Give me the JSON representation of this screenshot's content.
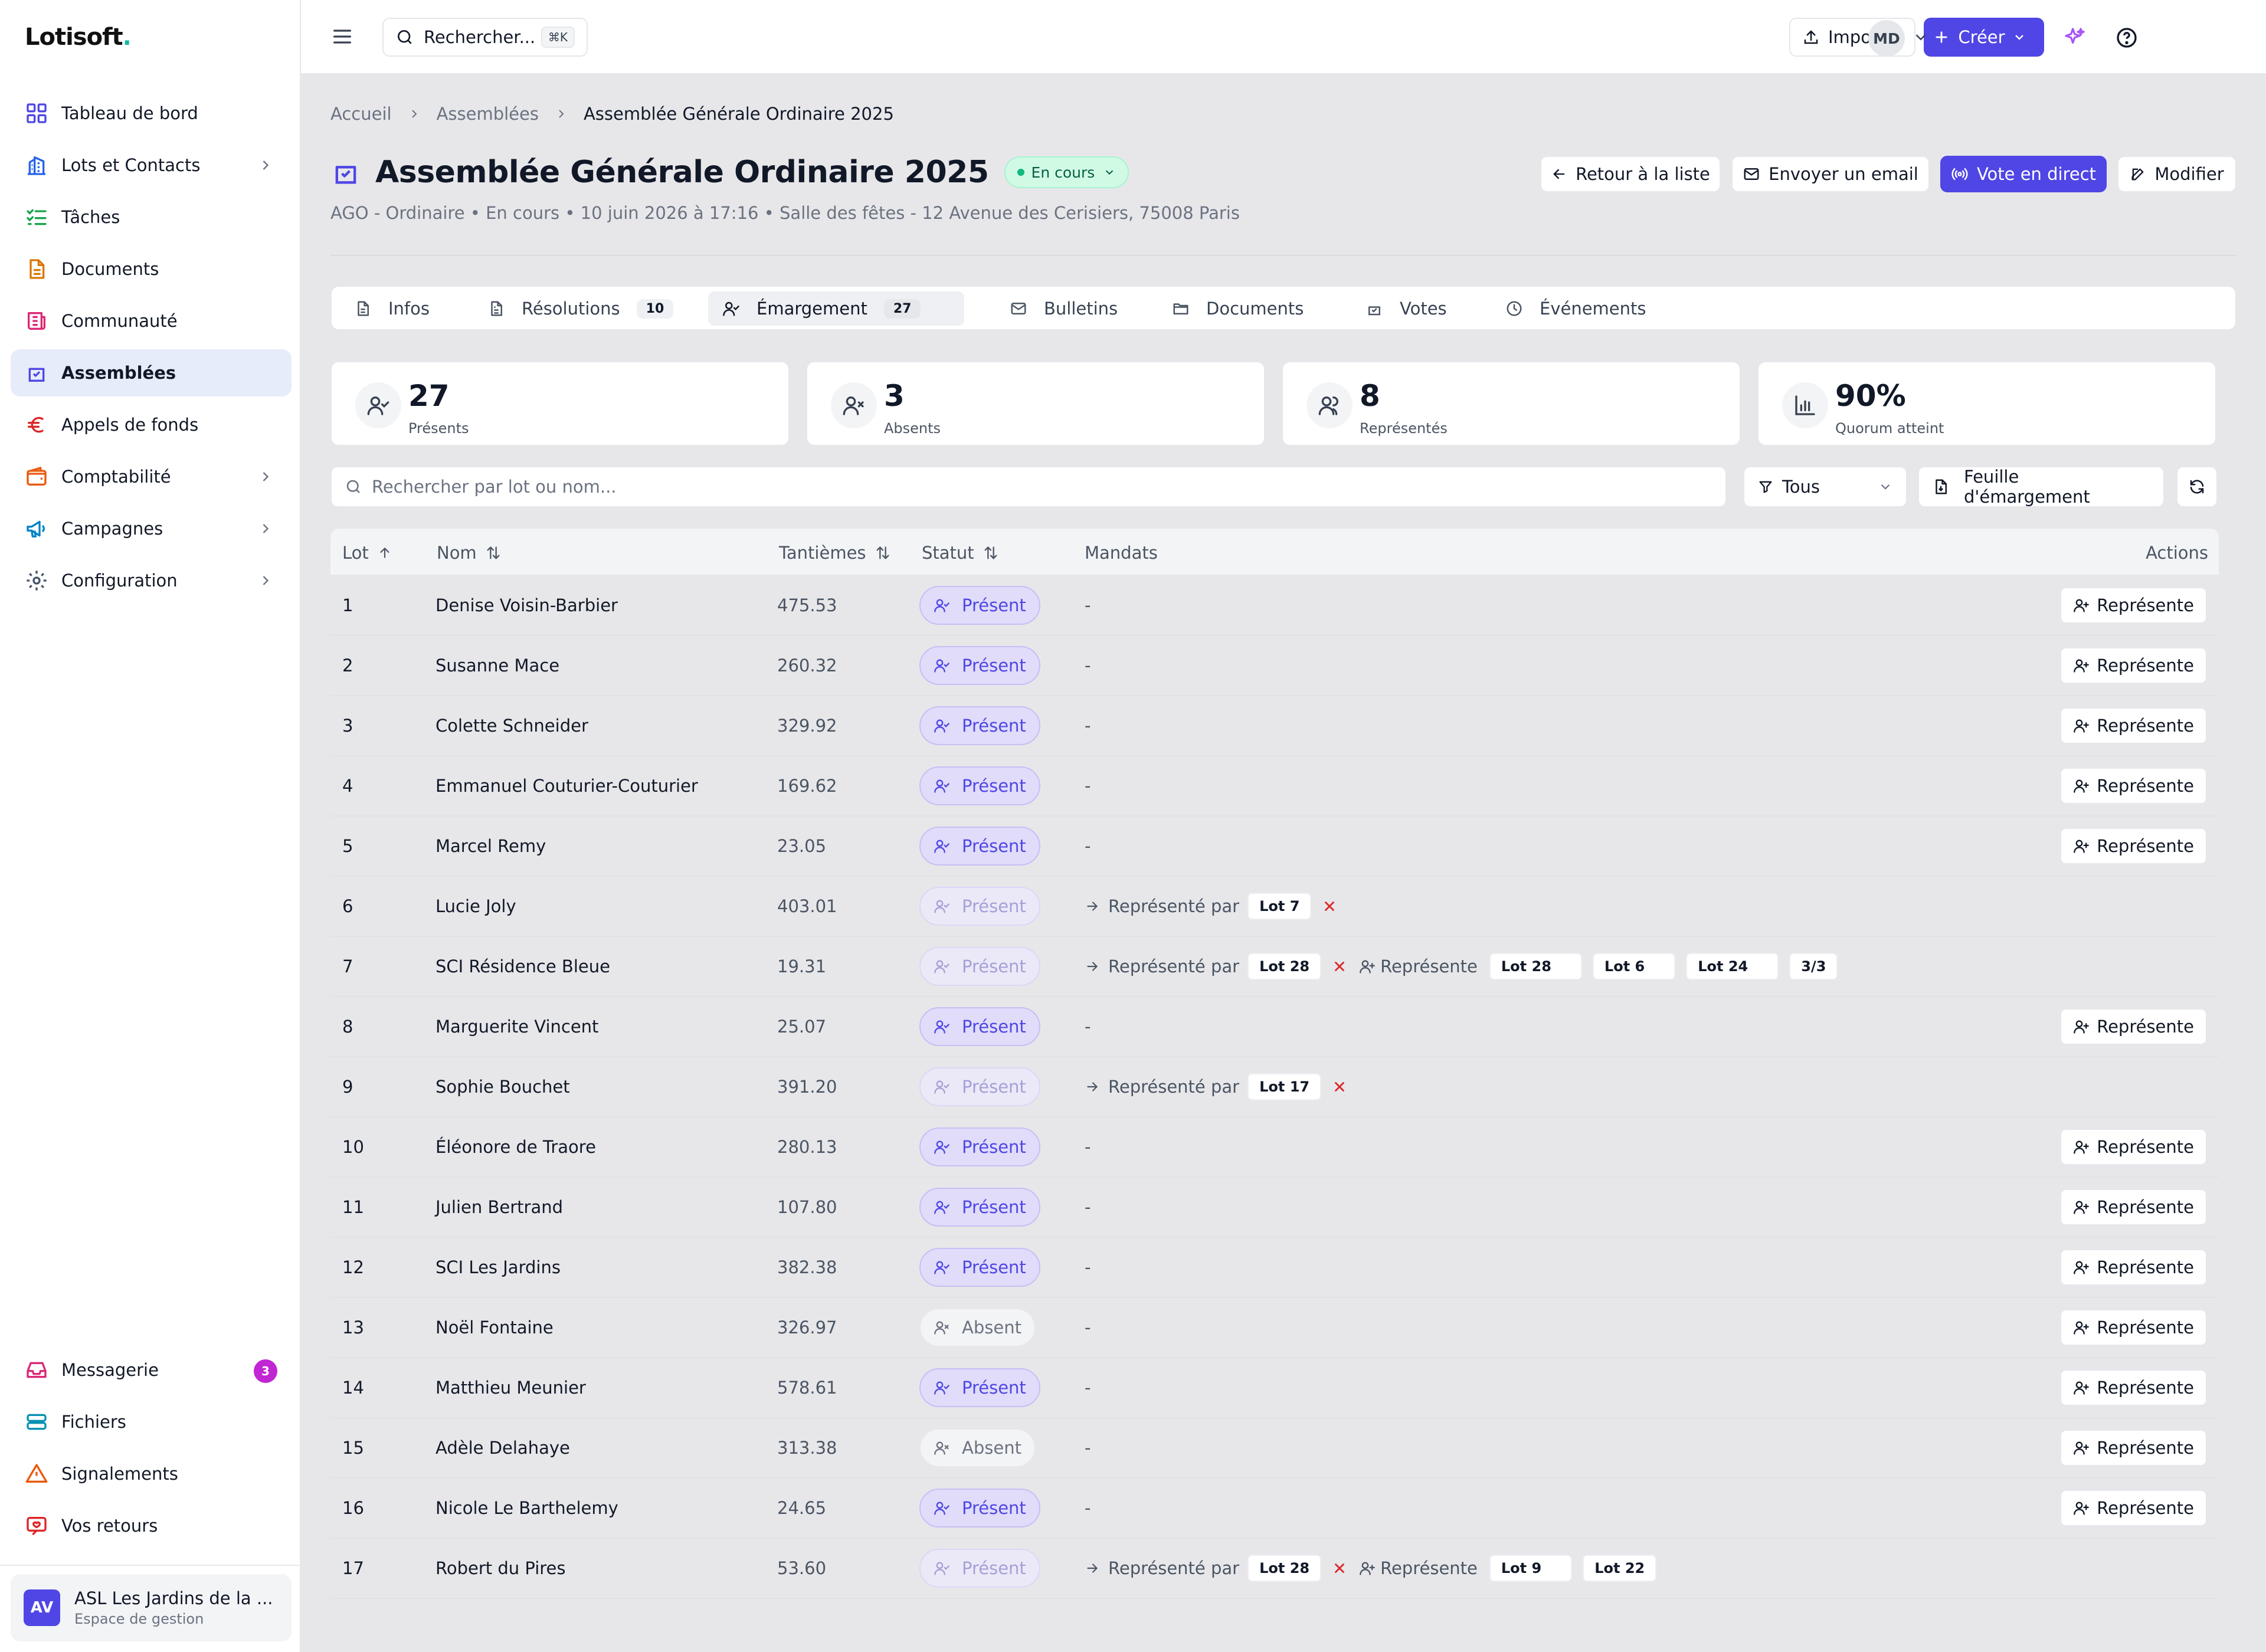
{
  "brand": {
    "name": "Lotisoft",
    "dot": "."
  },
  "sidebar": {
    "items": [
      {
        "label": "Tableau de bord",
        "icon": "dashboard-icon",
        "color": "#4f46e5"
      },
      {
        "label": "Lots et Contacts",
        "icon": "building-icon",
        "color": "#2563eb",
        "chevron": true
      },
      {
        "label": "Tâches",
        "icon": "checklist-icon",
        "color": "#16a34a"
      },
      {
        "label": "Documents",
        "icon": "document-icon",
        "color": "#d97706"
      },
      {
        "label": "Communauté",
        "icon": "newspaper-icon",
        "color": "#db2777"
      },
      {
        "label": "Assemblées",
        "icon": "vote-box-icon",
        "color": "#4f46e5",
        "active": true
      },
      {
        "label": "Appels de fonds",
        "icon": "euro-icon",
        "color": "#dc2626"
      },
      {
        "label": "Comptabilité",
        "icon": "wallet-icon",
        "color": "#ea580c",
        "chevron": true
      },
      {
        "label": "Campagnes",
        "icon": "megaphone-icon",
        "color": "#0284c7",
        "chevron": true
      },
      {
        "label": "Configuration",
        "icon": "gear-icon",
        "color": "#475569",
        "chevron": true
      }
    ],
    "bottom": [
      {
        "label": "Messagerie",
        "icon": "inbox-icon",
        "color": "#db2777",
        "badge": "3"
      },
      {
        "label": "Fichiers",
        "icon": "drive-icon",
        "color": "#0891b2"
      },
      {
        "label": "Signalements",
        "icon": "warning-icon",
        "color": "#ea580c"
      },
      {
        "label": "Vos retours",
        "icon": "feedback-icon",
        "color": "#dc2626"
      }
    ],
    "org": {
      "initials": "AV",
      "name": "ASL Les Jardins de la ...",
      "subtitle": "Espace de gestion"
    }
  },
  "topbar": {
    "search_label": "Rechercher...",
    "shortcut": "⌘K",
    "import_label": "Importer",
    "create_label": "Créer",
    "user_initials": "MD"
  },
  "breadcrumb": [
    "Accueil",
    "Assemblées",
    "Assemblée Générale Ordinaire 2025"
  ],
  "page": {
    "title": "Assemblée Générale Ordinaire 2025",
    "status": "En cours",
    "subtitle": "AGO - Ordinaire • En cours • 10 juin 2026 à 17:16 • Salle des fêtes - 12 Avenue des Cerisiers, 75008 Paris",
    "actions": {
      "back": "Retour à la liste",
      "email": "Envoyer un email",
      "live": "Vote en direct",
      "edit": "Modifier"
    }
  },
  "tabs": [
    {
      "label": "Infos",
      "icon": "file-icon"
    },
    {
      "label": "Résolutions",
      "icon": "file-text-icon",
      "count": "10"
    },
    {
      "label": "Émargement",
      "icon": "user-check-icon",
      "count": "27",
      "active": true
    },
    {
      "label": "Bulletins",
      "icon": "mail-icon"
    },
    {
      "label": "Documents",
      "icon": "folder-icon"
    },
    {
      "label": "Votes",
      "icon": "vote-icon"
    },
    {
      "label": "Événements",
      "icon": "clock-icon"
    }
  ],
  "stats": [
    {
      "value": "27",
      "label": "Présents",
      "icon": "user-check-icon"
    },
    {
      "value": "3",
      "label": "Absents",
      "icon": "user-x-icon"
    },
    {
      "value": "8",
      "label": "Représentés",
      "icon": "users-icon"
    },
    {
      "value": "90%",
      "label": "Quorum atteint",
      "icon": "bar-chart-icon"
    }
  ],
  "filters": {
    "search_placeholder": "Rechercher par lot ou nom...",
    "select": "Tous",
    "sheet": "Feuille d'émargement"
  },
  "table": {
    "columns": {
      "lot": "Lot",
      "nom": "Nom",
      "tantiemes": "Tantièmes",
      "statut": "Statut",
      "mandats": "Mandats",
      "actions": "Actions"
    },
    "represente_label": "Représente",
    "represented_by_label": "Représenté par",
    "rows": [
      {
        "lot": "1",
        "nom": "Denise Voisin-Barbier",
        "tantiemes": "475.53",
        "statut": "Présent",
        "mandat": "-"
      },
      {
        "lot": "2",
        "nom": "Susanne Mace",
        "tantiemes": "260.32",
        "statut": "Présent",
        "mandat": "-"
      },
      {
        "lot": "3",
        "nom": "Colette Schneider",
        "tantiemes": "329.92",
        "statut": "Présent",
        "mandat": "-"
      },
      {
        "lot": "4",
        "nom": "Emmanuel Couturier-Couturier",
        "tantiemes": "169.62",
        "statut": "Présent",
        "mandat": "-"
      },
      {
        "lot": "5",
        "nom": "Marcel Remy",
        "tantiemes": "23.05",
        "statut": "Présent",
        "mandat": "-"
      },
      {
        "lot": "6",
        "nom": "Lucie Joly",
        "tantiemes": "403.01",
        "statut": "Présent",
        "dim": true,
        "represented_by": "Lot 7"
      },
      {
        "lot": "7",
        "nom": "SCI Résidence Bleue",
        "tantiemes": "19.31",
        "statut": "Présent",
        "dim": true,
        "represented_by": "Lot 28",
        "represents": [
          "Lot 28",
          "Lot 6",
          "Lot 24",
          "3/3"
        ]
      },
      {
        "lot": "8",
        "nom": "Marguerite Vincent",
        "tantiemes": "25.07",
        "statut": "Présent",
        "mandat": "-"
      },
      {
        "lot": "9",
        "nom": "Sophie Bouchet",
        "tantiemes": "391.20",
        "statut": "Présent",
        "dim": true,
        "represented_by": "Lot 17"
      },
      {
        "lot": "10",
        "nom": "Éléonore de Traore",
        "tantiemes": "280.13",
        "statut": "Présent",
        "mandat": "-"
      },
      {
        "lot": "11",
        "nom": "Julien Bertrand",
        "tantiemes": "107.80",
        "statut": "Présent",
        "mandat": "-"
      },
      {
        "lot": "12",
        "nom": "SCI Les Jardins",
        "tantiemes": "382.38",
        "statut": "Présent",
        "mandat": "-"
      },
      {
        "lot": "13",
        "nom": "Noël Fontaine",
        "tantiemes": "326.97",
        "statut": "Absent",
        "mandat": "-"
      },
      {
        "lot": "14",
        "nom": "Matthieu Meunier",
        "tantiemes": "578.61",
        "statut": "Présent",
        "mandat": "-"
      },
      {
        "lot": "15",
        "nom": "Adèle Delahaye",
        "tantiemes": "313.38",
        "statut": "Absent",
        "mandat": "-"
      },
      {
        "lot": "16",
        "nom": "Nicole Le Barthelemy",
        "tantiemes": "24.65",
        "statut": "Présent",
        "mandat": "-"
      },
      {
        "lot": "17",
        "nom": "Robert du Pires",
        "tantiemes": "53.60",
        "statut": "Présent",
        "dim": true,
        "represented_by": "Lot 28",
        "represents": [
          "Lot 9",
          "Lot 22"
        ]
      }
    ]
  }
}
